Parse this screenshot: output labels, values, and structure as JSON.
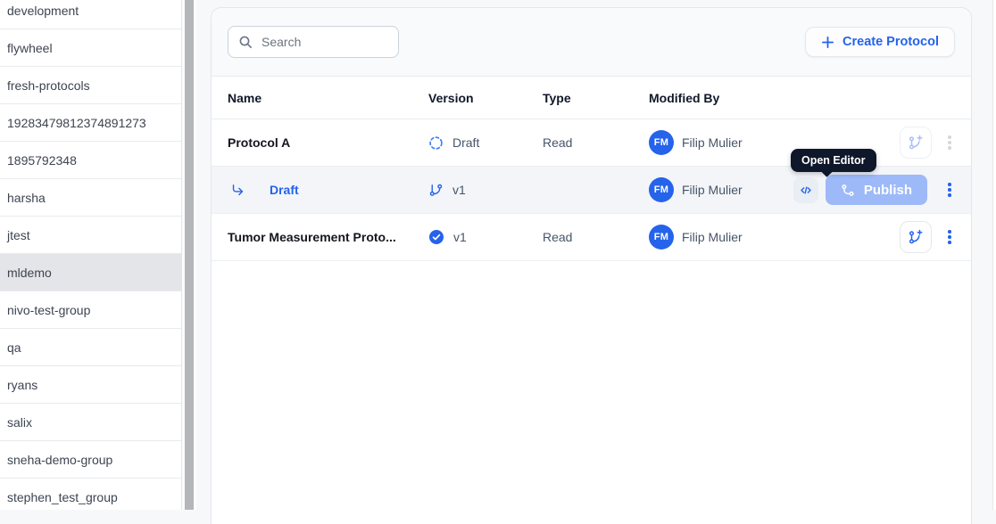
{
  "app": {
    "background": "#f7f8fa",
    "accent": "#2563eb"
  },
  "sidebar": {
    "items": [
      {
        "label": "development",
        "selected": false
      },
      {
        "label": "flywheel",
        "selected": false
      },
      {
        "label": "fresh-protocols",
        "selected": false
      },
      {
        "label": "19283479812374891273",
        "selected": false
      },
      {
        "label": "1895792348",
        "selected": false
      },
      {
        "label": "harsha",
        "selected": false
      },
      {
        "label": "jtest",
        "selected": false
      },
      {
        "label": "mldemo",
        "selected": true
      },
      {
        "label": "nivo-test-group",
        "selected": false
      },
      {
        "label": "qa",
        "selected": false
      },
      {
        "label": "ryans",
        "selected": false
      },
      {
        "label": "salix",
        "selected": false
      },
      {
        "label": "sneha-demo-group",
        "selected": false
      },
      {
        "label": "stephen_test_group",
        "selected": false
      }
    ]
  },
  "toolbar": {
    "search_placeholder": "Search",
    "create_label": "Create Protocol"
  },
  "table": {
    "columns": [
      "Name",
      "Version",
      "Type",
      "Modified By"
    ],
    "rows": [
      {
        "name": "Protocol A",
        "version_label": "Draft",
        "version_icon": "dashed-circle",
        "type": "Read",
        "avatar": "FM",
        "modified_by": "Filip Mulier"
      },
      {
        "link_label": "Draft",
        "version_label": "v1",
        "version_icon": "git-branch",
        "type": "",
        "avatar": "FM",
        "modified_by": "Filip Mulier",
        "publish_label": "Publish"
      },
      {
        "name": "Tumor Measurement Proto...",
        "version_label": "v1",
        "version_icon": "check-circle",
        "type": "Read",
        "avatar": "FM",
        "modified_by": "Filip Mulier"
      }
    ]
  },
  "tooltip": {
    "text": "Open Editor"
  },
  "colors": {
    "accent": "#2563eb",
    "publish_button_bg": "#9db9f8",
    "tooltip_bg": "#0f172a",
    "subrow_bg": "#f3f5f8",
    "sidebar_selected_bg": "#e4e5e8",
    "avatar_bg": "#2563eb",
    "scrollbar_thumb": "#b4b6ba"
  }
}
